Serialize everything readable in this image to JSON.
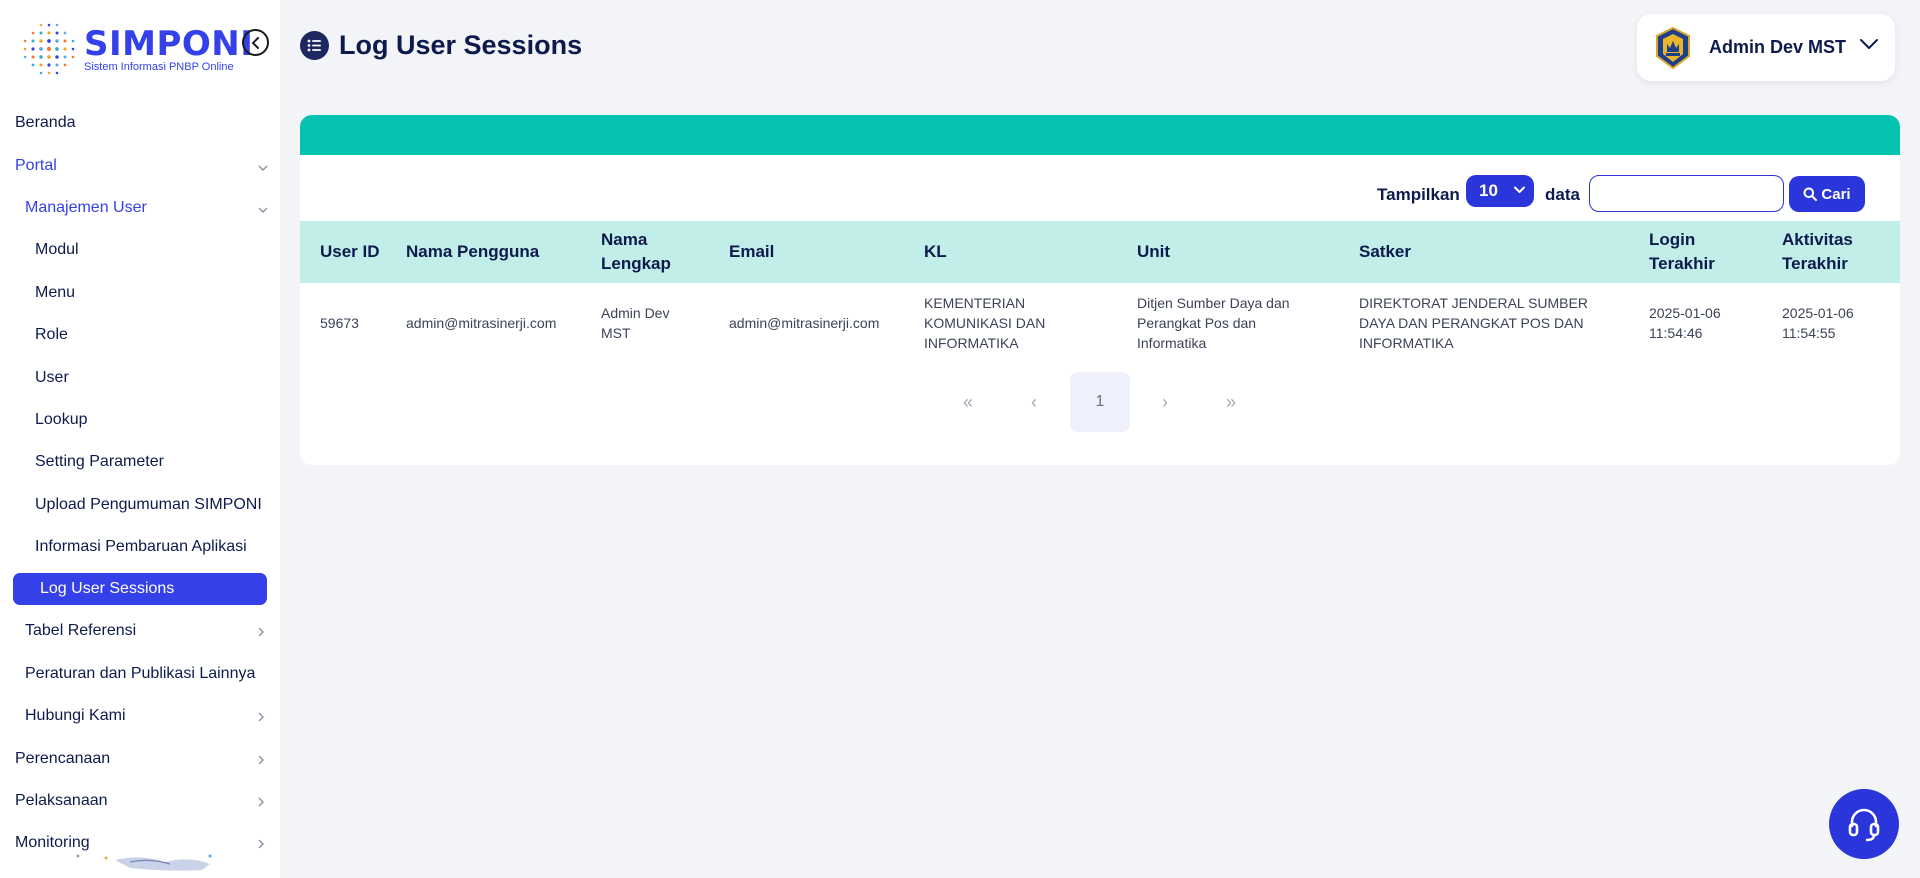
{
  "brand": {
    "name": "SIMPONI",
    "tagline": "Sistem Informasi PNBP Online"
  },
  "sidebar": {
    "items": [
      {
        "label": "Beranda",
        "level": 0,
        "chevron": ""
      },
      {
        "label": "Portal",
        "level": 0,
        "chevron": "down",
        "state": "active-parent"
      },
      {
        "label": "Manajemen User",
        "level": 1,
        "chevron": "down",
        "state": "active-parent"
      },
      {
        "label": "Modul",
        "level": 2,
        "chevron": ""
      },
      {
        "label": "Menu",
        "level": 2,
        "chevron": ""
      },
      {
        "label": "Role",
        "level": 2,
        "chevron": ""
      },
      {
        "label": "User",
        "level": 2,
        "chevron": ""
      },
      {
        "label": "Lookup",
        "level": 2,
        "chevron": ""
      },
      {
        "label": "Setting Parameter",
        "level": 2,
        "chevron": ""
      },
      {
        "label": "Upload Pengumuman SIMPONI",
        "level": 2,
        "chevron": ""
      },
      {
        "label": "Informasi Pembaruan Aplikasi",
        "level": 2,
        "chevron": ""
      },
      {
        "label": "Log User Sessions",
        "level": 2,
        "chevron": "",
        "state": "selected"
      },
      {
        "label": "Tabel Referensi",
        "level": 1,
        "chevron": "right"
      },
      {
        "label": "Peraturan dan Publikasi Lainnya",
        "level": 1,
        "chevron": ""
      },
      {
        "label": "Hubungi Kami",
        "level": 1,
        "chevron": "right"
      },
      {
        "label": "Perencanaan",
        "level": 0,
        "chevron": "right"
      },
      {
        "label": "Pelaksanaan",
        "level": 0,
        "chevron": "right"
      },
      {
        "label": "Monitoring",
        "level": 0,
        "chevron": "right"
      }
    ]
  },
  "header": {
    "title": "Log User Sessions",
    "user_name": "Admin Dev MST"
  },
  "toolbar": {
    "show_label": "Tampilkan",
    "page_size": "10",
    "data_label": "data",
    "search_value": "",
    "search_button": "Cari"
  },
  "table": {
    "columns": [
      "User ID",
      "Nama Pengguna",
      "Nama Lengkap",
      "Email",
      "KL",
      "Unit",
      "Satker",
      "Login Terakhir",
      "Aktivitas Terakhir"
    ],
    "rows": [
      [
        "59673",
        "admin@mitrasinerji.com",
        "Admin Dev MST",
        "admin@mitrasinerji.com",
        "KEMENTERIAN KOMUNIKASI DAN INFORMATIKA",
        "Ditjen Sumber Daya dan Perangkat Pos dan Informatika",
        "DIREKTORAT JENDERAL SUMBER DAYA DAN PERANGKAT POS DAN INFORMATIKA",
        "2025-01-06 11:54:46",
        "2025-01-06 11:54:55"
      ]
    ]
  },
  "pagination": {
    "first": "«",
    "prev": "‹",
    "current": "1",
    "next": "›",
    "last": "»"
  },
  "colors": {
    "primary": "#2a36d9",
    "brand": "#3441e8",
    "teal_bar": "#03c3b0",
    "table_header": "#c2eeea",
    "text_dark": "#0d1b4c",
    "background": "#f3f4f8"
  },
  "icons": {
    "collapse": "chevron-left-circle-icon",
    "title": "list-icon",
    "search": "search-icon",
    "help": "headset-icon",
    "user_avatar": "emblem-icon"
  }
}
